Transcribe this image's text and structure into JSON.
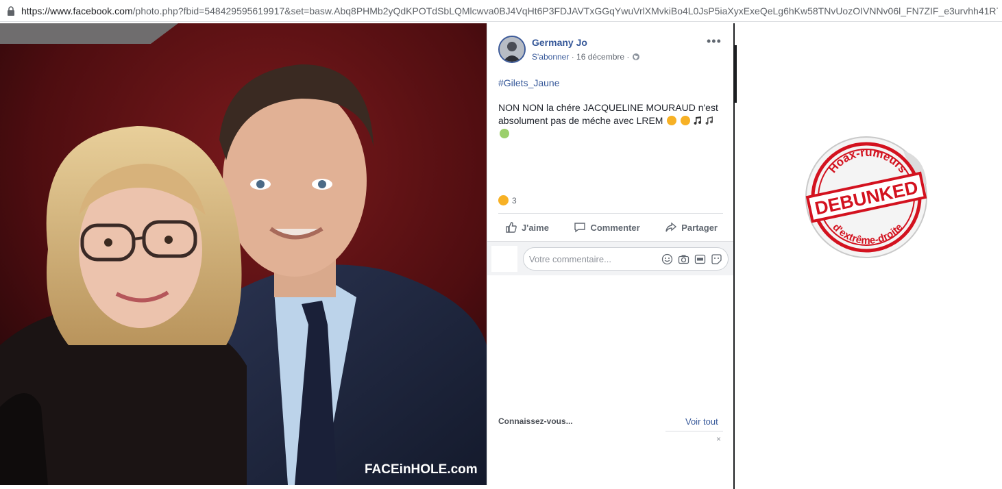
{
  "browser": {
    "url_host": "https://www.facebook.com",
    "url_rest": "/photo.php?fbid=548429595619917&set=basw.Abq8PHMb2yQdKPOTdSbLQMlcwva0BJ4VqHt6P3FDJAVTxGGqYwuVrlXMvkiBo4L0JsP5iaXyxExeQeLg6hKw58TNvUozOIVNNv06l_FN7ZIF_e3urvhh41R7iUqr..."
  },
  "photo": {
    "watermark": "FACEinHOLE.com"
  },
  "post": {
    "author": "Germany Jo",
    "follow": "S'abonner",
    "separator": "·",
    "date": "16 décembre",
    "more": "•••",
    "hashtag": "#Gilets_Jaune",
    "text": "NON NON la chére JACQUELINE MOURAUD n'est absolument pas de méche avec LREM",
    "reaction_count": "3"
  },
  "actions": {
    "like": "J'aime",
    "comment": "Commenter",
    "share": "Partager"
  },
  "comment_box": {
    "placeholder": "Votre commentaire..."
  },
  "suggestions": {
    "title": "Connaissez-vous...",
    "see_all": "Voir tout",
    "close": "×"
  },
  "stamp": {
    "top_text": "Hoax-rumeurs",
    "middle_text": "DEBUNKED",
    "bottom_text": "d'extrême-droite",
    "color": "#d3121f"
  },
  "colors": {
    "link": "#365899",
    "photo_background": "#5a1013"
  },
  "icons": {
    "lock": "lock-icon",
    "like": "thumbs-up-icon",
    "comment": "speech-bubble-icon",
    "share": "share-arrow-icon",
    "globe": "globe-icon"
  }
}
